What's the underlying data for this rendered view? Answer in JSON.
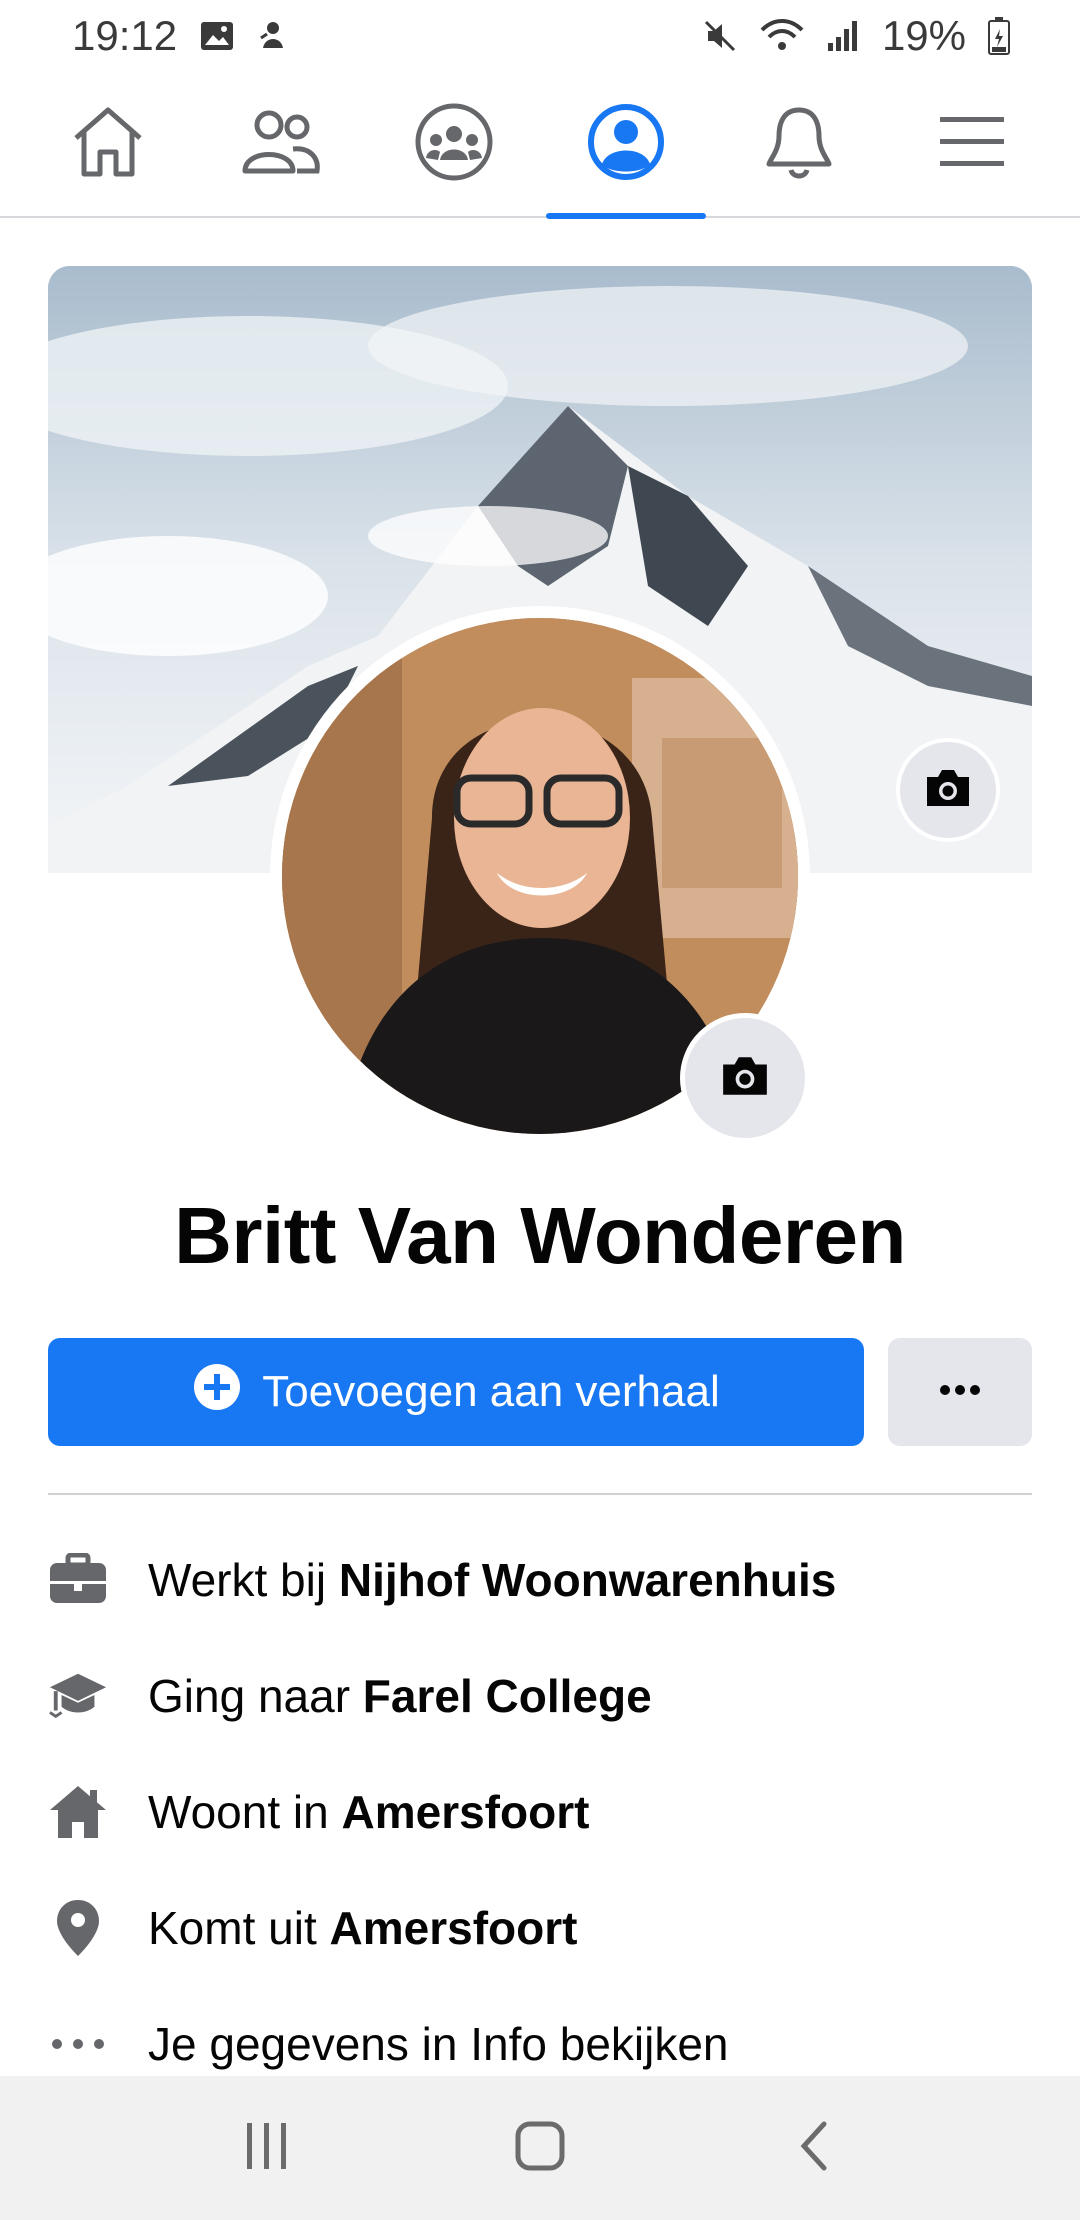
{
  "status_bar": {
    "time": "19:12",
    "battery": "19%",
    "icons_left": [
      "gallery-icon",
      "notification-icon"
    ],
    "icons_right": [
      "mute-icon",
      "wifi-icon",
      "signal-icon",
      "battery-icon"
    ]
  },
  "nav": {
    "tabs": [
      {
        "name": "home",
        "icon": "home-icon",
        "active": false
      },
      {
        "name": "friends",
        "icon": "friends-icon",
        "active": false
      },
      {
        "name": "groups",
        "icon": "groups-icon",
        "active": false
      },
      {
        "name": "profile",
        "icon": "profile-icon",
        "active": true
      },
      {
        "name": "notifications",
        "icon": "bell-icon",
        "active": false
      },
      {
        "name": "menu",
        "icon": "menu-icon",
        "active": false
      }
    ],
    "accent": "#1877f2"
  },
  "profile": {
    "name": "Britt Van Wonderen"
  },
  "actions": {
    "add_story_label": "Toevoegen aan verhaal",
    "more_label": "•••"
  },
  "details": [
    {
      "icon": "briefcase-icon",
      "prefix": "Werkt bij ",
      "value": "Nijhof Woonwarenhuis"
    },
    {
      "icon": "graduation-cap-icon",
      "prefix": "Ging naar ",
      "value": "Farel College"
    },
    {
      "icon": "house-icon",
      "prefix": "Woont in ",
      "value": "Amersfoort"
    },
    {
      "icon": "location-pin-icon",
      "prefix": "Komt uit ",
      "value": "Amersfoort"
    },
    {
      "icon": "more-dots-icon",
      "prefix": "Je gegevens in Info bekijken",
      "value": ""
    }
  ],
  "colors": {
    "primary_button": "#1877f2",
    "secondary_button": "#e4e6eb",
    "icon_grey": "#65676b"
  }
}
